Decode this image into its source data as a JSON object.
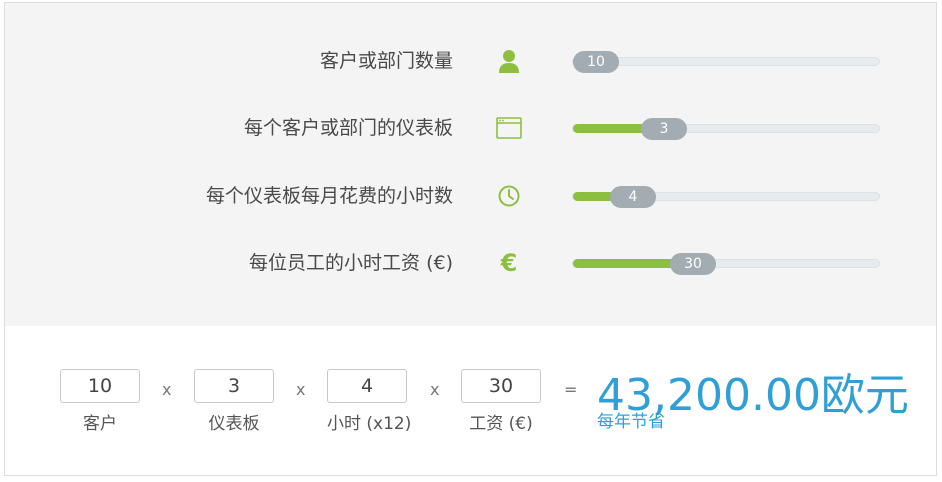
{
  "sliders": [
    {
      "label": "客户或部门数量",
      "icon": "person-icon",
      "value": "10",
      "fraction": 0.0
    },
    {
      "label": "每个客户或部门的仪表板",
      "icon": "browser-window-icon",
      "value": "3",
      "fraction": 0.26
    },
    {
      "label": "每个仪表板每月花费的小时数",
      "icon": "clock-icon",
      "value": "4",
      "fraction": 0.14
    },
    {
      "label": "每位员工的小时工资 (€)",
      "icon": "euro-icon",
      "value": "30",
      "fraction": 0.37
    }
  ],
  "calc": {
    "items": [
      {
        "value": "10",
        "label": "客户"
      },
      {
        "value": "3",
        "label": "仪表板"
      },
      {
        "value": "4",
        "label": "小时 (x12)"
      },
      {
        "value": "30",
        "label": "工资 (€)"
      }
    ],
    "multiply": "x",
    "equals": "=",
    "result": "43,200.00欧元",
    "result_label": "每年节省"
  },
  "colors": {
    "accent_green": "#8cbf3f",
    "accent_blue": "#2f9fd8",
    "handle": "#a3acb2"
  }
}
